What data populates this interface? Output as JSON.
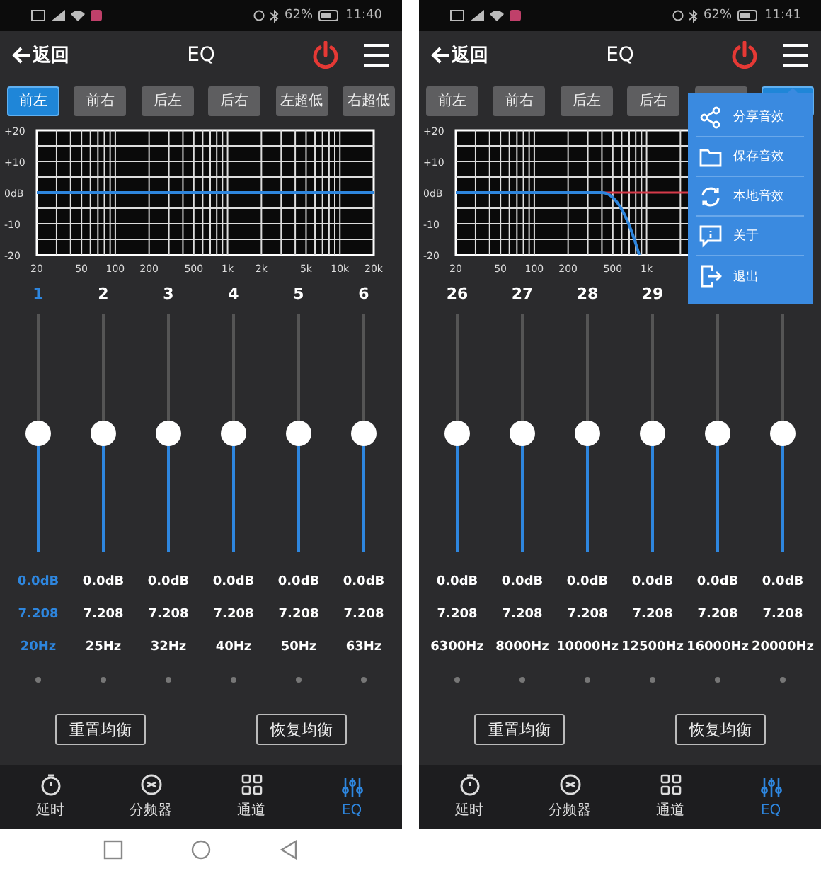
{
  "screens": [
    {
      "status_bar": {
        "battery": "62%",
        "time": "11:40"
      },
      "header": {
        "back": "返回",
        "title": "EQ"
      },
      "channels": [
        {
          "label": "前左",
          "selected": true
        },
        {
          "label": "前右",
          "selected": false
        },
        {
          "label": "后左",
          "selected": false
        },
        {
          "label": "后右",
          "selected": false
        },
        {
          "label": "左超低",
          "selected": false
        },
        {
          "label": "右超低",
          "selected": false
        }
      ],
      "graph": {
        "y_labels": [
          "+20",
          "+10",
          "0dB",
          "-10",
          "-20"
        ],
        "x_labels": [
          "20",
          "50",
          "100",
          "200",
          "500",
          "1k",
          "2k",
          "5k",
          "10k",
          "20k"
        ],
        "kind": "flat"
      },
      "bands": [
        {
          "number": "1",
          "level": 0.5,
          "gain": "0.0dB",
          "q": "7.208",
          "freq": "20Hz",
          "selected": true
        },
        {
          "number": "2",
          "level": 0.5,
          "gain": "0.0dB",
          "q": "7.208",
          "freq": "25Hz",
          "selected": false
        },
        {
          "number": "3",
          "level": 0.5,
          "gain": "0.0dB",
          "q": "7.208",
          "freq": "32Hz",
          "selected": false
        },
        {
          "number": "4",
          "level": 0.5,
          "gain": "0.0dB",
          "q": "7.208",
          "freq": "40Hz",
          "selected": false
        },
        {
          "number": "5",
          "level": 0.5,
          "gain": "0.0dB",
          "q": "7.208",
          "freq": "50Hz",
          "selected": false
        },
        {
          "number": "6",
          "level": 0.5,
          "gain": "0.0dB",
          "q": "7.208",
          "freq": "63Hz",
          "selected": false
        }
      ],
      "buttons": [
        "重置均衡",
        "恢复均衡"
      ],
      "nav": [
        {
          "label": "延时",
          "selected": false
        },
        {
          "label": "分频器",
          "selected": false
        },
        {
          "label": "通道",
          "selected": false
        },
        {
          "label": "EQ",
          "selected": true
        }
      ],
      "system_nav": true
    },
    {
      "status_bar": {
        "battery": "62%",
        "time": "11:41"
      },
      "header": {
        "back": "返回",
        "title": "EQ"
      },
      "channels": [
        {
          "label": "前左",
          "selected": false
        },
        {
          "label": "前右",
          "selected": false
        },
        {
          "label": "后左",
          "selected": false
        },
        {
          "label": "后右",
          "selected": false
        },
        {
          "selected": false
        },
        {
          "selected": true
        }
      ],
      "graph": {
        "y_labels": [
          "+20",
          "+10",
          "0dB",
          "-10",
          "-20"
        ],
        "x_labels": [
          "20",
          "50",
          "100",
          "200",
          "500",
          "1k"
        ],
        "kind": "lowpass"
      },
      "bands": [
        {
          "number": "26",
          "level": 0.5,
          "gain": "0.0dB",
          "q": "7.208",
          "freq": "6300Hz",
          "selected": false
        },
        {
          "number": "27",
          "level": 0.5,
          "gain": "0.0dB",
          "q": "7.208",
          "freq": "8000Hz",
          "selected": false
        },
        {
          "number": "28",
          "level": 0.5,
          "gain": "0.0dB",
          "q": "7.208",
          "freq": "10000Hz",
          "selected": false
        },
        {
          "number": "29",
          "level": 0.5,
          "gain": "0.0dB",
          "q": "7.208",
          "freq": "12500Hz",
          "selected": false
        },
        {
          "level": 0.5,
          "gain": "0.0dB",
          "q": "7.208",
          "freq": "16000Hz",
          "selected": false
        },
        {
          "level": 0.5,
          "gain": "0.0dB",
          "q": "7.208",
          "freq": "20000Hz",
          "selected": false
        }
      ],
      "buttons": [
        "重置均衡",
        "恢复均衡"
      ],
      "nav": [
        {
          "label": "延时",
          "selected": false
        },
        {
          "label": "分频器",
          "selected": false
        },
        {
          "label": "通道",
          "selected": false
        },
        {
          "label": "EQ",
          "selected": true
        }
      ],
      "menu": {
        "items": [
          {
            "label": "分享音效",
            "kind": "share"
          },
          {
            "label": "保存音效",
            "kind": "save"
          },
          {
            "label": "本地音效",
            "kind": "local"
          },
          {
            "label": "关于",
            "kind": "about"
          },
          {
            "label": "退出",
            "kind": "exit"
          }
        ]
      },
      "system_nav": false
    }
  ]
}
